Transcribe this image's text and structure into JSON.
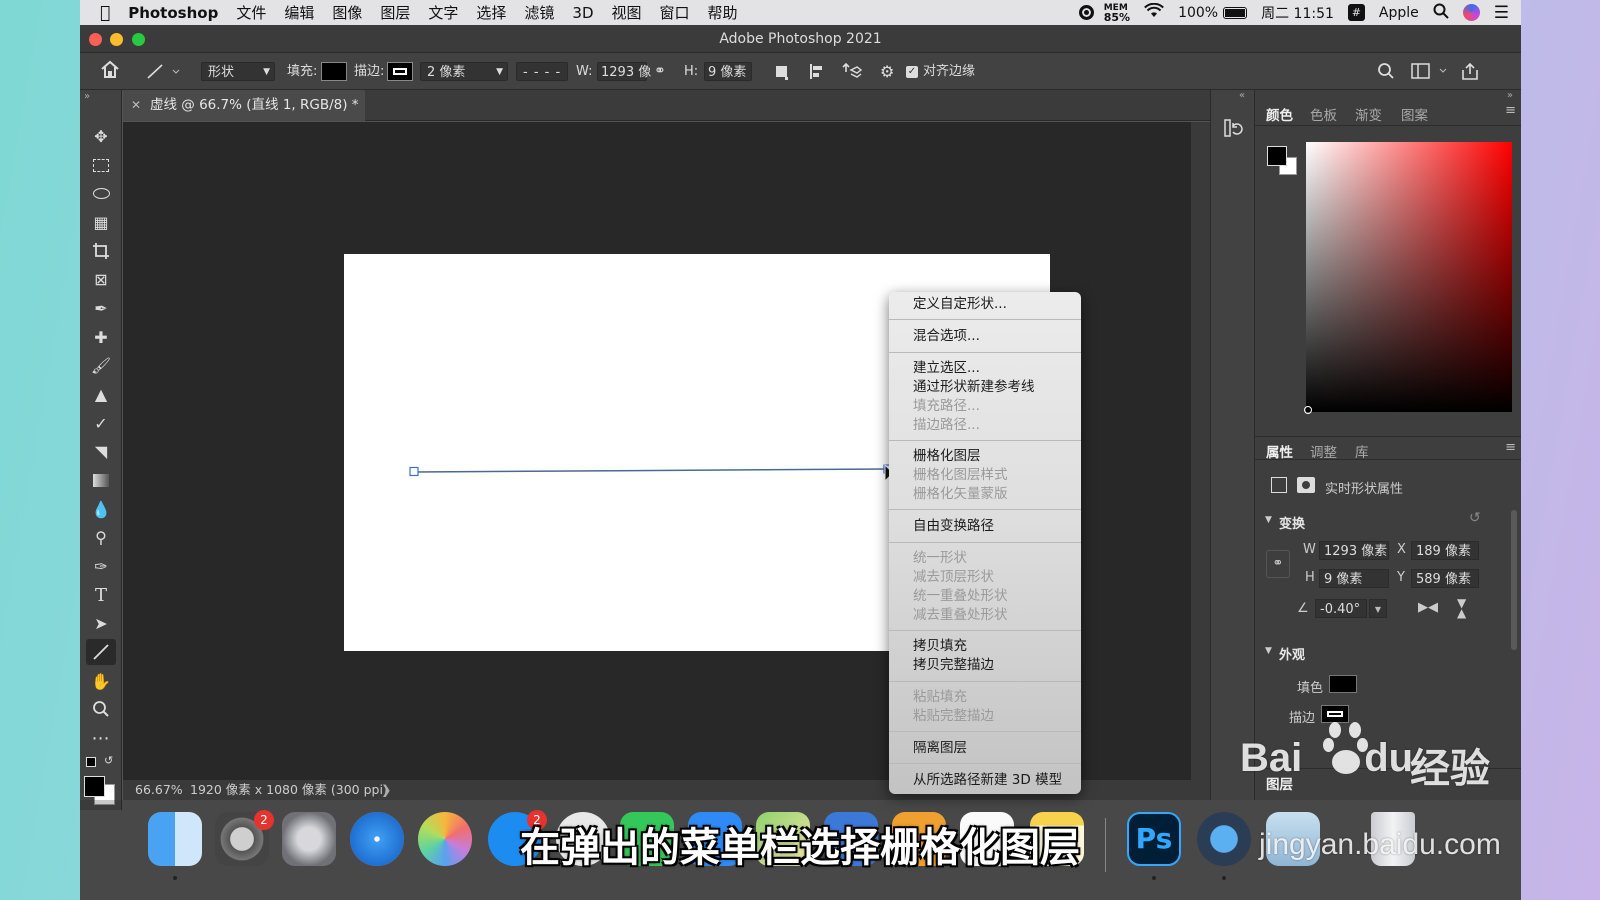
{
  "menubar": {
    "app": "Photoshop",
    "items": [
      "文件",
      "编辑",
      "图像",
      "图层",
      "文字",
      "选择",
      "滤镜",
      "3D",
      "视图",
      "窗口",
      "帮助"
    ],
    "mem_label": "MEM",
    "mem_value": "85%",
    "battery": "100%",
    "datetime": "周二 11:51",
    "user": "Apple"
  },
  "window": {
    "title": "Adobe Photoshop 2021"
  },
  "options": {
    "mode": "形状",
    "fill_label": "填充:",
    "stroke_label": "描边:",
    "stroke_width": "2 像素",
    "w_label": "W:",
    "w_value": "1293 像",
    "h_label": "H:",
    "h_value": "9 像素",
    "align_edges": "对齐边缘"
  },
  "document": {
    "tab_title": "虚线 @ 66.7% (直线 1, RGB/8) *",
    "zoom": "66.67%",
    "info": "1920 像素 x 1080 像素 (300 ppi)"
  },
  "context_menu": {
    "items": [
      {
        "label": "定义自定形状...",
        "enabled": true
      },
      {
        "label": "混合选项...",
        "enabled": true
      },
      {
        "label": "建立选区...",
        "enabled": true
      },
      {
        "label": "通过形状新建参考线",
        "enabled": true
      },
      {
        "label": "填充路径...",
        "enabled": false
      },
      {
        "label": "描边路径...",
        "enabled": false
      },
      {
        "label": "栅格化图层",
        "enabled": true
      },
      {
        "label": "栅格化图层样式",
        "enabled": false
      },
      {
        "label": "栅格化矢量蒙版",
        "enabled": false
      },
      {
        "label": "自由变换路径",
        "enabled": true
      },
      {
        "label": "统一形状",
        "enabled": false
      },
      {
        "label": "减去顶层形状",
        "enabled": false
      },
      {
        "label": "统一重叠处形状",
        "enabled": false
      },
      {
        "label": "减去重叠处形状",
        "enabled": false
      },
      {
        "label": "拷贝填充",
        "enabled": true
      },
      {
        "label": "拷贝完整描边",
        "enabled": true
      },
      {
        "label": "粘贴填充",
        "enabled": false
      },
      {
        "label": "粘贴完整描边",
        "enabled": false
      },
      {
        "label": "隔离图层",
        "enabled": true
      },
      {
        "label": "从所选路径新建 3D 模型",
        "enabled": true
      }
    ]
  },
  "color_panel": {
    "tabs": [
      "颜色",
      "色板",
      "渐变",
      "图案"
    ]
  },
  "properties_panel": {
    "tabs": [
      "属性",
      "调整",
      "库"
    ],
    "type_label": "实时形状属性",
    "transform_label": "变换",
    "w_label": "W",
    "w_value": "1293 像素",
    "x_label": "X",
    "x_value": "189 像素",
    "h_label": "H",
    "h_value": "9 像素",
    "y_label": "Y",
    "y_value": "589 像素",
    "angle_value": "-0.40°",
    "appearance_label": "外观",
    "fill_label": "填色",
    "stroke_label": "描边"
  },
  "layers_panel": {
    "tab": "图层"
  },
  "dock": {
    "badges": [
      "2",
      "2"
    ],
    "ps_label": "Ps"
  },
  "subtitle": "在弹出的菜单栏选择栅格化图层",
  "watermark": {
    "logo_a": "Bai",
    "logo_b": "du",
    "brand": "经验",
    "url": "jingyan.baidu.com"
  },
  "colors": {
    "accent": "#1473e6",
    "panel": "#424242",
    "canvas": "#282828"
  }
}
